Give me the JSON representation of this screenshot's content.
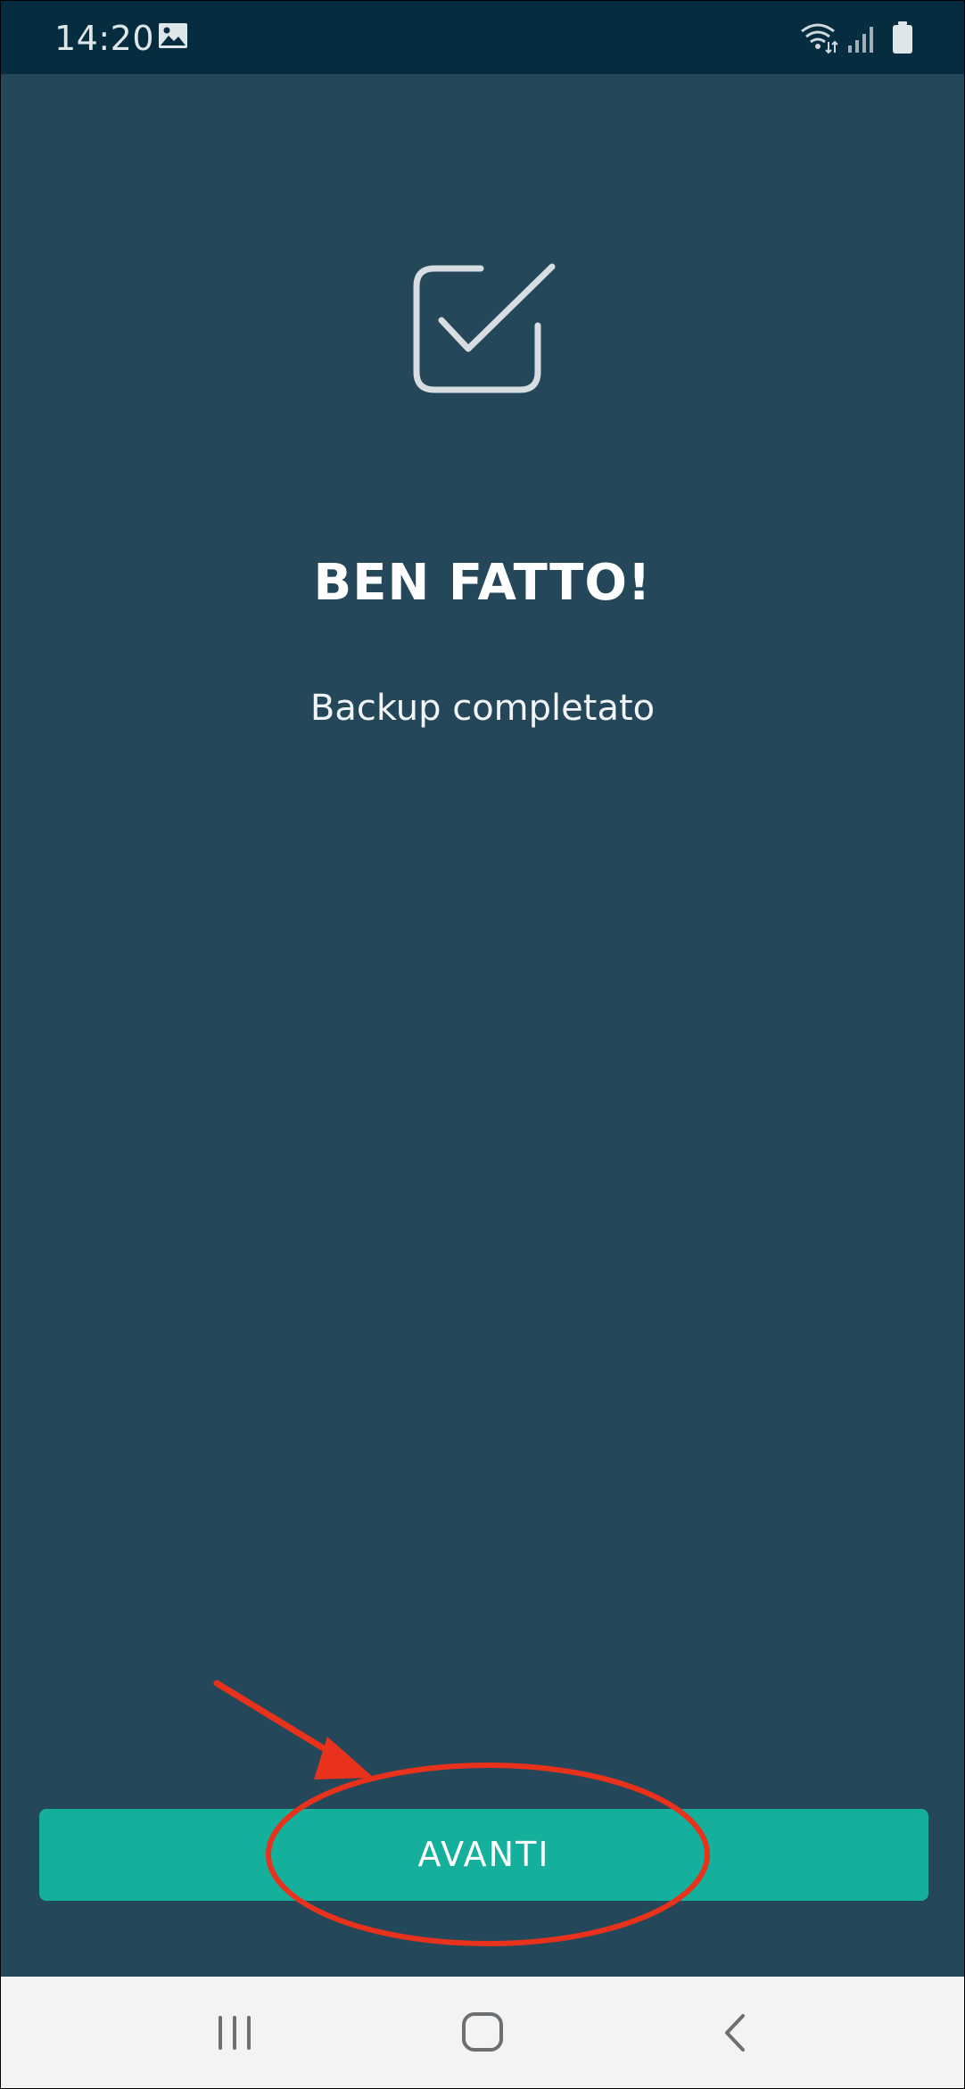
{
  "status_bar": {
    "time": "14:20",
    "icons": [
      "image-icon",
      "wifi-icon",
      "signal-icon",
      "battery-icon"
    ]
  },
  "main": {
    "icon": "checkbox-checked-icon",
    "title": "BEN FATTO!",
    "subtitle": "Backup completato",
    "next_button_label": "AVANTI"
  },
  "annotation": {
    "color": "#e8321c",
    "shapes": [
      "arrow-icon",
      "highlight-ellipse"
    ]
  },
  "nav_bar": {
    "icons": [
      "recent-apps-icon",
      "home-icon",
      "back-icon"
    ]
  },
  "colors": {
    "background": "#244859",
    "status_bar": "#062c3f",
    "accent": "#14b09c",
    "nav_bar": "#f3f3f3"
  }
}
